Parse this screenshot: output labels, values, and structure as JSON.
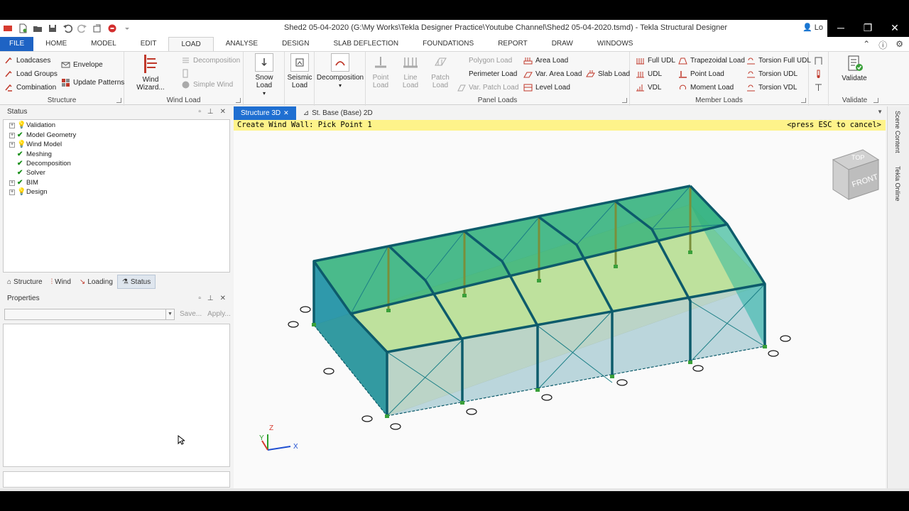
{
  "title": "Shed2 05-04-2020 (G:\\My Works\\Tekla Designer Practice\\Youtube Channel\\Shed2 05-04-2020.tsmd) - Tekla Structural Designer",
  "user_label": "Lo",
  "tabs": [
    "FILE",
    "HOME",
    "MODEL",
    "EDIT",
    "LOAD",
    "ANALYSE",
    "DESIGN",
    "SLAB DEFLECTION",
    "FOUNDATIONS",
    "REPORT",
    "DRAW",
    "WINDOWS"
  ],
  "active_tab": "LOAD",
  "ribbon": {
    "structure": {
      "label": "Structure",
      "loadcases": "Loadcases",
      "load_groups": "Load Groups",
      "combination": "Combination",
      "envelope": "Envelope",
      "update_patterns": "Update Patterns"
    },
    "wind": {
      "label": "Wind Load",
      "wind_wizard": "Wind Wizard...",
      "decomposition": "Decomposition",
      "simple_wind": "Simple Wind"
    },
    "snow": {
      "snow_load": "Snow Load"
    },
    "seismic": {
      "line1": "Seismic",
      "line2": "Load"
    },
    "decomposition": {
      "label": "Decomposition"
    },
    "panel": {
      "label": "Panel Loads",
      "point_load_1": "Point",
      "point_load_2": "Load",
      "line_load": "Line Load",
      "patch_load_1": "Patch",
      "patch_load_2": "Load",
      "polygon_load": "Polygon Load",
      "perimeter_load": "Perimeter Load",
      "var_patch_load": "Var. Patch Load",
      "area_load": "Area Load",
      "var_area_load": "Var. Area Load",
      "level_load": "Level Load",
      "slab_load": "Slab Load"
    },
    "member": {
      "label": "Member Loads",
      "full_udl": "Full UDL",
      "udl": "UDL",
      "vdl": "VDL",
      "trapezoidal_load": "Trapezoidal Load",
      "point_load": "Point Load",
      "moment_load": "Moment Load",
      "torsion_full_udl": "Torsion Full UDL",
      "torsion_udl": "Torsion UDL",
      "torsion_vdl": "Torsion VDL"
    },
    "validate": {
      "label": "Validate",
      "button": "Validate"
    }
  },
  "status_panel": {
    "title": "Status",
    "items": [
      {
        "label": "Validation",
        "state": "pending"
      },
      {
        "label": "Model Geometry",
        "state": "ok"
      },
      {
        "label": "Wind Model",
        "state": "pending"
      },
      {
        "label": "Meshing",
        "state": "ok"
      },
      {
        "label": "Decomposition",
        "state": "ok"
      },
      {
        "label": "Solver",
        "state": "ok"
      },
      {
        "label": "BIM",
        "state": "ok"
      },
      {
        "label": "Design",
        "state": "pending"
      }
    ]
  },
  "panel_tabs": [
    "Structure",
    "Wind",
    "Loading",
    "Status"
  ],
  "panel_tabs_active": "Status",
  "properties_panel": {
    "title": "Properties",
    "save": "Save...",
    "apply": "Apply..."
  },
  "view_tabs": [
    "Structure 3D",
    "St. Base (Base) 2D"
  ],
  "view_tabs_active": "Structure 3D",
  "prompt": {
    "left": "Create Wind Wall: Pick Point 1",
    "right": "<press ESC to cancel>"
  },
  "view_cube": {
    "top": "TOP",
    "front": "FRONT"
  },
  "axis": {
    "x": "X",
    "y": "Y",
    "z": "Z"
  },
  "right_rail": [
    "Scene Content",
    "Tekla Online"
  ],
  "colors": {
    "accent": "#1f6fd1",
    "file_tab": "#1e63c4",
    "prompt_bg": "#fef38a",
    "roof": "#2fb07a",
    "floor": "#fbf3a6",
    "members": "#0d5b6b",
    "wall": "#0f8aa0"
  }
}
